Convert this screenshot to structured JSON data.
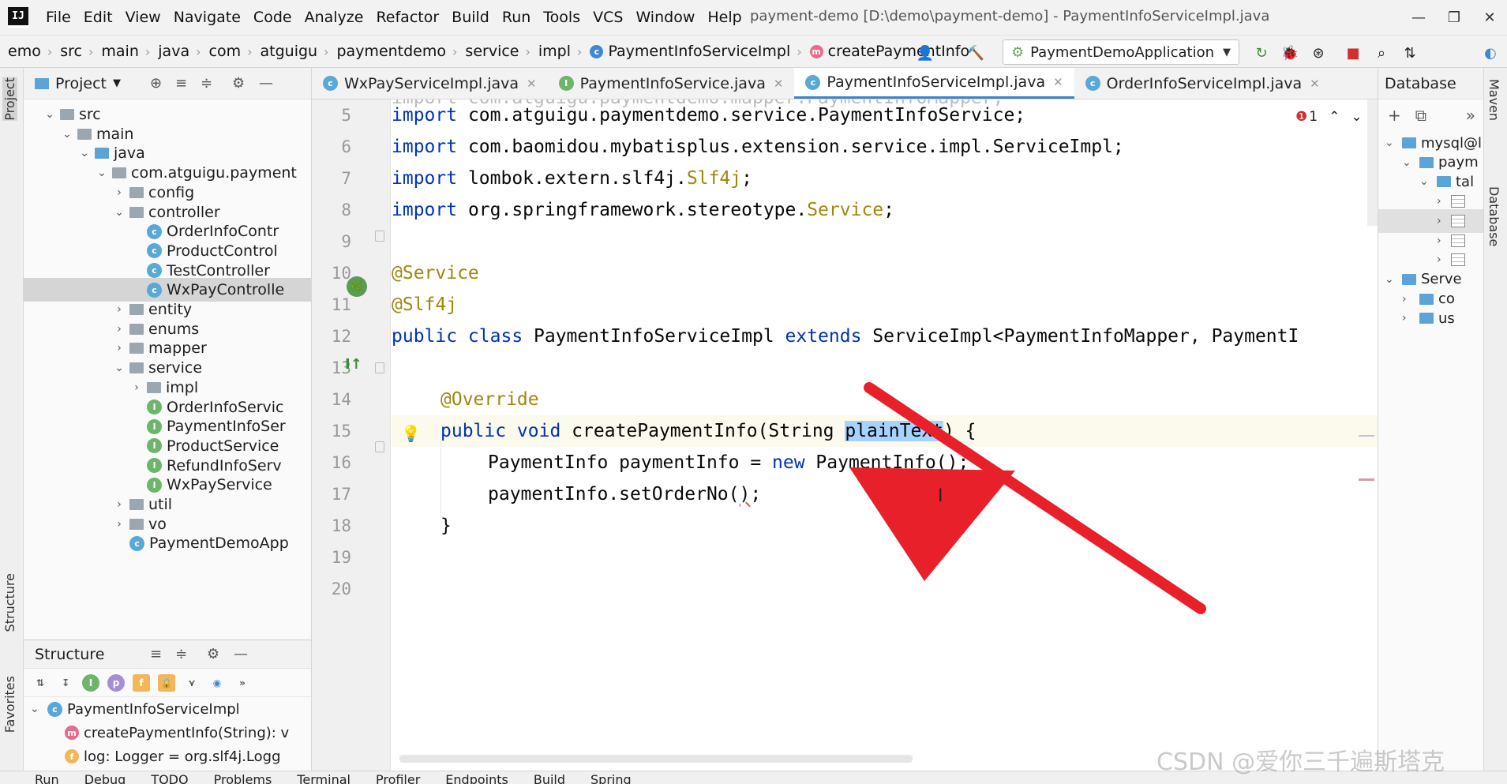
{
  "menubar": {
    "logo": "IJ",
    "items": [
      "File",
      "Edit",
      "View",
      "Navigate",
      "Code",
      "Analyze",
      "Refactor",
      "Build",
      "Run",
      "Tools",
      "VCS",
      "Window",
      "Help"
    ],
    "window_title": "payment-demo [D:\\demo\\payment-demo] - PaymentInfoServiceImpl.java"
  },
  "breadcrumb": [
    "emo",
    "src",
    "main",
    "java",
    "com",
    "atguigu",
    "paymentdemo",
    "service",
    "impl",
    "PaymentInfoServiceImpl",
    "createPaymentInfo"
  ],
  "run_config": "PaymentDemoApplication",
  "left_strip": {
    "project": "Project",
    "structure": "Structure",
    "favorites": "Favorites"
  },
  "project_panel": {
    "title": "Project",
    "tree": [
      {
        "label": "src",
        "type": "folder",
        "indent": 0,
        "expanded": true
      },
      {
        "label": "main",
        "type": "folder",
        "indent": 1,
        "expanded": true
      },
      {
        "label": "java",
        "type": "folder-blue",
        "indent": 2,
        "expanded": true
      },
      {
        "label": "com.atguigu.payment",
        "type": "folder",
        "indent": 3,
        "expanded": true
      },
      {
        "label": "config",
        "type": "folder",
        "indent": 4,
        "expanded": false
      },
      {
        "label": "controller",
        "type": "folder",
        "indent": 4,
        "expanded": true
      },
      {
        "label": "OrderInfoContr",
        "type": "class",
        "indent": 5
      },
      {
        "label": "ProductControl",
        "type": "class",
        "indent": 5
      },
      {
        "label": "TestController",
        "type": "class",
        "indent": 5
      },
      {
        "label": "WxPayControlle",
        "type": "class",
        "indent": 5,
        "selected": true
      },
      {
        "label": "entity",
        "type": "folder",
        "indent": 4,
        "expanded": false
      },
      {
        "label": "enums",
        "type": "folder",
        "indent": 4,
        "expanded": false
      },
      {
        "label": "mapper",
        "type": "folder",
        "indent": 4,
        "expanded": false
      },
      {
        "label": "service",
        "type": "folder",
        "indent": 4,
        "expanded": true
      },
      {
        "label": "impl",
        "type": "folder",
        "indent": 5,
        "expanded": false
      },
      {
        "label": "OrderInfoServic",
        "type": "interface",
        "indent": 5
      },
      {
        "label": "PaymentInfoSer",
        "type": "interface",
        "indent": 5
      },
      {
        "label": "ProductService",
        "type": "interface",
        "indent": 5
      },
      {
        "label": "RefundInfoServ",
        "type": "interface",
        "indent": 5
      },
      {
        "label": "WxPayService",
        "type": "interface",
        "indent": 5
      },
      {
        "label": "util",
        "type": "folder",
        "indent": 4,
        "expanded": false
      },
      {
        "label": "vo",
        "type": "folder",
        "indent": 4,
        "expanded": false
      },
      {
        "label": "PaymentDemoApp",
        "type": "class",
        "indent": 4
      }
    ]
  },
  "structure_panel": {
    "title": "Structure",
    "rows": [
      {
        "label": "PaymentInfoServiceImpl",
        "type": "class"
      },
      {
        "label": "createPaymentInfo(String): v",
        "type": "method"
      },
      {
        "label": "log: Logger = org.slf4j.Logg",
        "type": "field"
      }
    ]
  },
  "editor": {
    "tabs": [
      {
        "label": "WxPayServiceImpl.java",
        "type": "class",
        "active": false
      },
      {
        "label": "PaymentInfoService.java",
        "type": "interface",
        "active": false
      },
      {
        "label": "PaymentInfoServiceImpl.java",
        "type": "class",
        "active": true
      },
      {
        "label": "OrderInfoServiceImpl.java",
        "type": "class",
        "active": false
      }
    ],
    "problem_count": "1",
    "line_numbers": [
      "5",
      "6",
      "7",
      "8",
      "9",
      "10",
      "11",
      "12",
      "13",
      "14",
      "15",
      "16",
      "17",
      "18",
      "19",
      "20"
    ],
    "code": {
      "l5": {
        "kw": "import",
        "rest": " com.atguigu.paymentdemo.service.PaymentInfoService;"
      },
      "l6": {
        "kw": "import",
        "rest": " com.baomidou.mybatisplus.extension.service.impl.ServiceImpl;"
      },
      "l7": {
        "kw": "import",
        "rest": " lombok.extern.slf4j.",
        "cls": "Slf4j",
        "end": ";"
      },
      "l8": {
        "kw": "import",
        "rest": " org.springframework.stereotype.",
        "cls": "Service",
        "end": ";"
      },
      "l10": "@Service",
      "l11": "@Slf4j",
      "l12": {
        "kw": "public class",
        "rest": " PaymentInfoServiceImpl ",
        "kw2": "extends",
        "rest2": " ServiceImpl<PaymentInfoMapper, PaymentI"
      },
      "l14": "@Override",
      "l15": {
        "kw": "public void",
        "rest": " createPaymentInfo(String ",
        "sel": "plainText",
        "end": ") {"
      },
      "l16": {
        "pre": "PaymentInfo paymentInfo = ",
        "kw": "new",
        "rest": " PaymentInfo();"
      },
      "l17": {
        "pre": "paymentInfo.setOrderNo(",
        "squig": ")",
        "end": ";"
      },
      "l18": "}"
    }
  },
  "right_panel": {
    "title": "Database",
    "rows": [
      {
        "label": "mysql@l",
        "indent": 0
      },
      {
        "label": "paym",
        "indent": 1
      },
      {
        "label": "tal",
        "indent": 2
      },
      {
        "label": "",
        "indent": 3,
        "table": true
      },
      {
        "label": "",
        "indent": 3,
        "table": true
      },
      {
        "label": "",
        "indent": 3,
        "table": true
      },
      {
        "label": "",
        "indent": 3,
        "table": true
      },
      {
        "label": "Serve",
        "indent": 0
      },
      {
        "label": "co",
        "indent": 1
      },
      {
        "label": "us",
        "indent": 1
      }
    ],
    "strip": {
      "maven": "Maven",
      "database": "Database"
    }
  },
  "bottom_bar": [
    "Run",
    "Debug",
    "TODO",
    "Problems",
    "Terminal",
    "Profiler",
    "Endpoints",
    "Build",
    "Spring"
  ],
  "watermark": "CSDN @爱你三千遍斯塔克",
  "colors": {
    "accent": "#4083c9",
    "keyword": "#0033b3",
    "annotation": "#9e880d",
    "arrow": "#e8202a",
    "selection": "#a6d2ff"
  }
}
